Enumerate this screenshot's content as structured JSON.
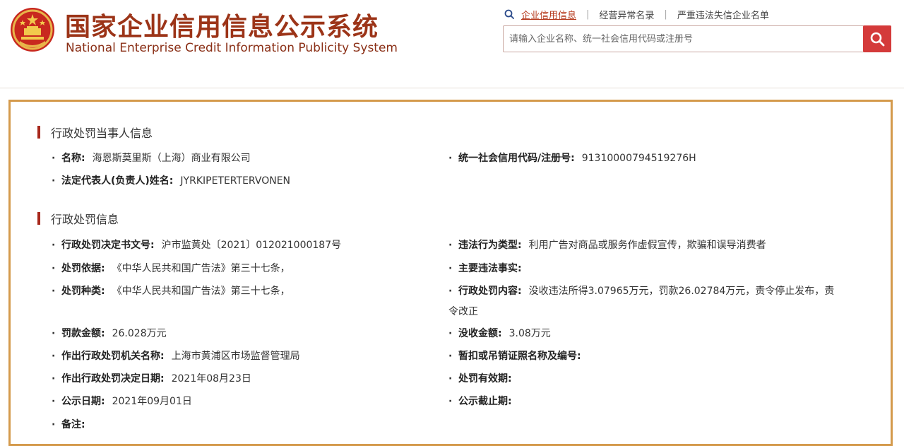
{
  "header": {
    "title_cn": "国家企业信用信息公示系统",
    "title_en": "National Enterprise Credit Information Publicity System",
    "nav": [
      "企业信用信息",
      "经营异常名录",
      "严重违法失信企业名单"
    ],
    "search_placeholder": "请输入企业名称、统一社会信用代码或注册号"
  },
  "sections": [
    {
      "title": "行政处罚当事人信息",
      "fields": [
        {
          "label": "名称:",
          "value": "海恩斯莫里斯（上海）商业有限公司"
        },
        {
          "label": "统一社会信用代码/注册号:",
          "value": "91310000794519276H"
        },
        {
          "label": "法定代表人(负责人)姓名:",
          "value": "JYRKIPETERTERVONEN"
        }
      ]
    },
    {
      "title": "行政处罚信息",
      "fields": [
        {
          "label": "行政处罚决定书文号:",
          "value": "沪市监黄处〔2021〕012021000187号"
        },
        {
          "label": "违法行为类型:",
          "value": "利用广告对商品或服务作虚假宣传，欺骗和误导消费者"
        },
        {
          "label": "处罚依据:",
          "value": "《中华人民共和国广告法》第三十七条，"
        },
        {
          "label": "主要违法事实:",
          "value": ""
        },
        {
          "label": "处罚种类:",
          "value": "《中华人民共和国广告法》第三十七条，"
        },
        {
          "label": "行政处罚内容:",
          "value": "没收违法所得3.07965万元，罚款26.02784万元，责令停止发布，责令改正"
        },
        {
          "label": "罚款金额:",
          "value": "26.028万元"
        },
        {
          "label": "没收金额:",
          "value": "3.08万元"
        },
        {
          "label": "作出行政处罚机关名称:",
          "value": "上海市黄浦区市场监督管理局"
        },
        {
          "label": "暂扣或吊销证照名称及编号:",
          "value": ""
        },
        {
          "label": "作出行政处罚决定日期:",
          "value": "2021年08月23日"
        },
        {
          "label": "处罚有效期:",
          "value": ""
        },
        {
          "label": "公示日期:",
          "value": "2021年09月01日"
        },
        {
          "label": "公示截止期:",
          "value": ""
        },
        {
          "label": "备注:",
          "value": ""
        }
      ]
    }
  ],
  "colors": {
    "brand": "#9c3418",
    "accent": "#d43a3a",
    "border": "#d49a4c",
    "section_bar": "#a8281c"
  }
}
